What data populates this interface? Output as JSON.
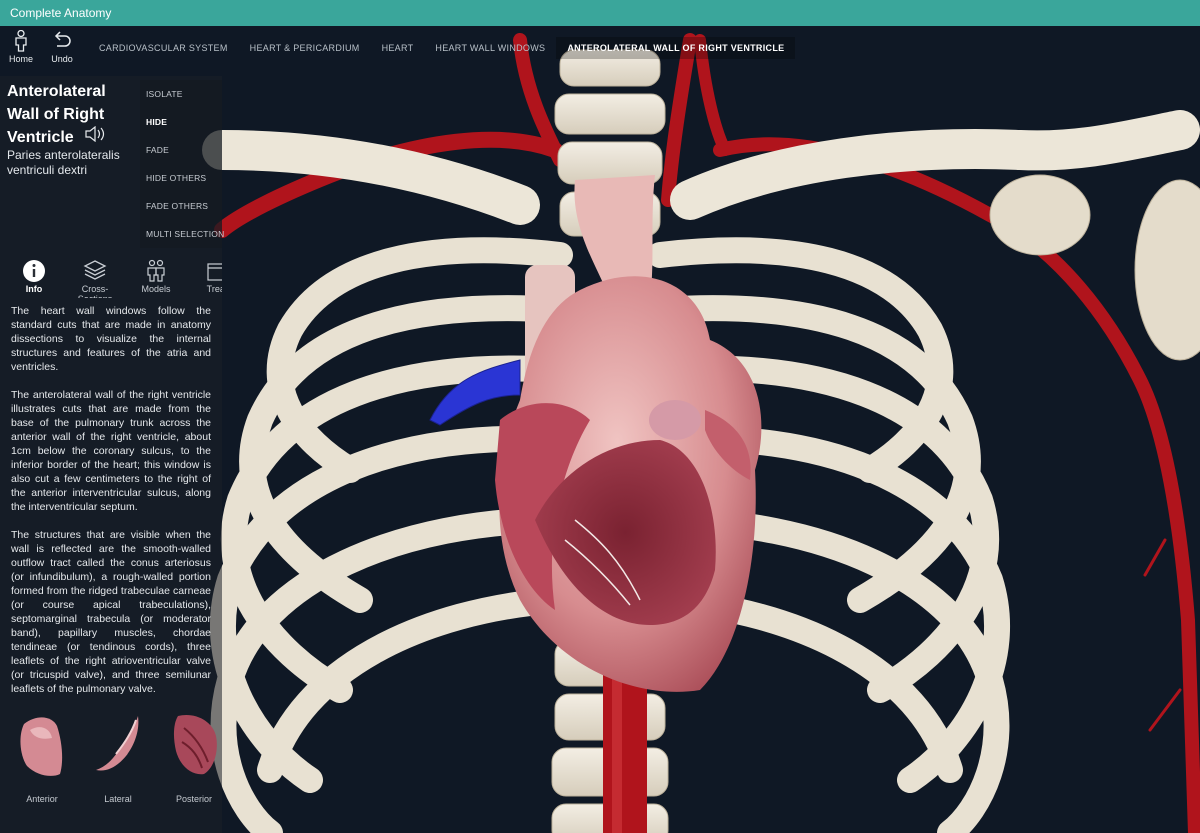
{
  "app": {
    "title": "Complete Anatomy"
  },
  "toolbar": {
    "home_label": "Home",
    "undo_label": "Undo",
    "breadcrumbs": [
      "CARDIOVASCULAR SYSTEM",
      "HEART & PERICARDIUM",
      "HEART",
      "HEART WALL WINDOWS",
      "ANTEROLATERAL WALL OF RIGHT VENTRICLE"
    ]
  },
  "structure": {
    "title": "Anterolateral Wall of Right Ventricle",
    "latin": "Paries anterolateralis ventriculi dextri"
  },
  "actions": [
    "ISOLATE",
    "HIDE",
    "FADE",
    "HIDE OTHERS",
    "FADE OTHERS",
    "MULTI SELECTION"
  ],
  "tabs": [
    {
      "label": "Info",
      "icon": "info-icon"
    },
    {
      "label": "Cross-Sections",
      "icon": "layers-icon"
    },
    {
      "label": "Models",
      "icon": "people-icon"
    },
    {
      "label": "Treat",
      "icon": "clapper-icon"
    }
  ],
  "description": [
    "The heart wall windows follow the standard cuts that are made in anatomy dissections to visualize the internal structures and features of the atria and ventricles.",
    "The anterolateral wall of the right ventricle illustrates cuts that are made from the base of the pulmonary trunk across the anterior wall of the right ventricle, about 1cm below the coronary sulcus, to the inferior border of the heart; this window is also cut a few centimeters to the right of the anterior interventricular sulcus, along the interventricular septum.",
    "The structures that are visible when the wall is reflected are the smooth-walled outflow tract called the conus arteriosus (or infundibulum), a rough-walled portion formed from the ridged trabeculae carneae (or course apical trabeculations), septomarginal trabecula (or moderator band), papillary muscles, chordae tendineae (or tendinous cords), three leaflets of the right atrioventricular valve (or tricuspid valve), and three semilunar leaflets of the pulmonary valve."
  ],
  "views": [
    "Anterior",
    "Lateral",
    "Posterior"
  ],
  "colors": {
    "titlebar": "#3aa69b",
    "background": "#0f1825",
    "bone": "#e8e1d2",
    "artery": "#b0141c",
    "vein": "#2a35d4",
    "myocardium": "#c9707a"
  }
}
